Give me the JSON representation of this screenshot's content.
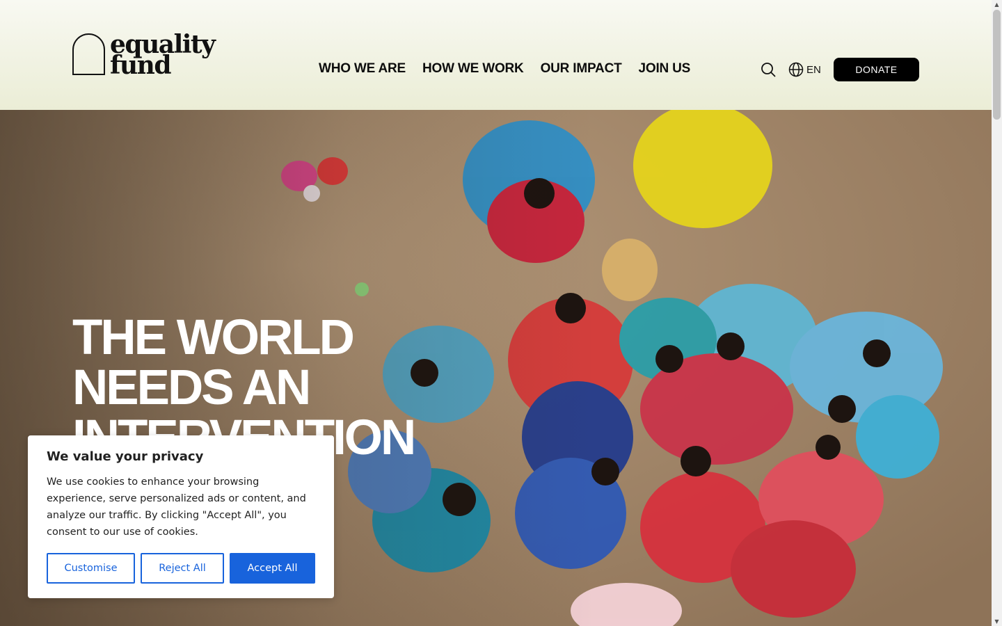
{
  "brand": {
    "line1": "equality",
    "line2": "fund"
  },
  "nav": {
    "items": [
      {
        "label": "WHO WE ARE"
      },
      {
        "label": "HOW WE WORK"
      },
      {
        "label": "OUR IMPACT"
      },
      {
        "label": "JOIN US"
      }
    ]
  },
  "header": {
    "search_icon": "search-icon",
    "language_icon": "globe-icon",
    "language": "EN",
    "donate_label": "DONATE"
  },
  "hero": {
    "lines": [
      "THE WORLD",
      "NEEDS AN",
      "INTERVENTION"
    ]
  },
  "cookie": {
    "title": "We value your privacy",
    "text": "We use cookies to enhance your browsing experience, serve personalized ads or content, and analyze our traffic. By clicking \"Accept All\", you consent to our use of cookies.",
    "customise_label": "Customise",
    "reject_label": "Reject All",
    "accept_label": "Accept All"
  },
  "colors": {
    "header_bg": "#eef0dc",
    "donate_bg": "#000000",
    "cookie_accent": "#1863dc"
  }
}
